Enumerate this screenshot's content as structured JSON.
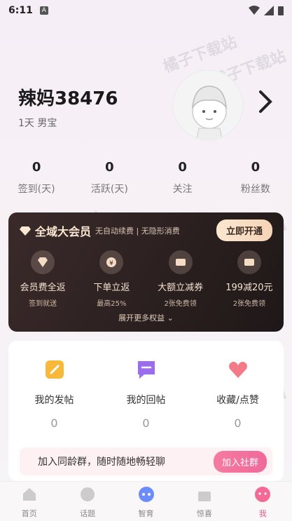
{
  "status": {
    "time": "6:11",
    "mini": "A"
  },
  "watermark": "橘子下载站",
  "profile": {
    "name": "辣妈38476",
    "info": "1天 男宝"
  },
  "stats": [
    {
      "num": "0",
      "label": "签到(天)"
    },
    {
      "num": "0",
      "label": "活跃(天)"
    },
    {
      "num": "0",
      "label": "关注"
    },
    {
      "num": "0",
      "label": "粉丝数"
    }
  ],
  "vip": {
    "title": "全域大会员",
    "sub": "无自动续费 | 无隐形消费",
    "button": "立即开通",
    "items": [
      {
        "t1": "会员费全返",
        "t2": "签到就送"
      },
      {
        "t1": "下单立返",
        "t2": "最高25%"
      },
      {
        "t1": "大额立减券",
        "t2": "2张免费领"
      },
      {
        "t1": "199减20元",
        "t2": "2张免费领"
      }
    ],
    "more": "展开更多权益"
  },
  "actions": [
    {
      "label": "我的发帖",
      "num": "0"
    },
    {
      "label": "我的回帖",
      "num": "0"
    },
    {
      "label": "收藏/点赞",
      "num": "0"
    }
  ],
  "group": {
    "text": "加入同龄群，随时随地畅轻聊",
    "button": "加入社群"
  },
  "tabs": [
    {
      "label": "首页"
    },
    {
      "label": "话题"
    },
    {
      "label": "智育"
    },
    {
      "label": "惊喜"
    },
    {
      "label": "我"
    }
  ]
}
